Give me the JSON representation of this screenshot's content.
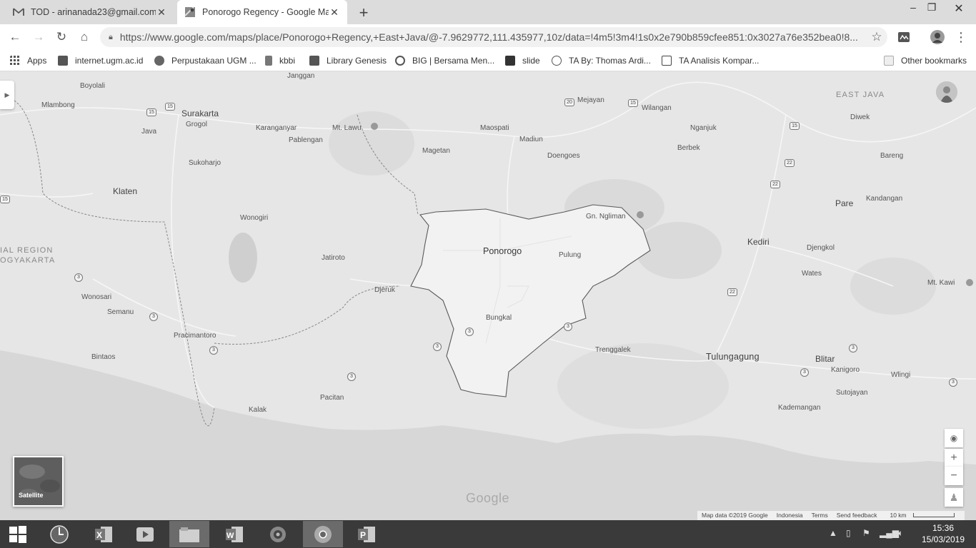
{
  "tabs": [
    {
      "title": "TOD - arinanada23@gmail.com -",
      "icon": "gmail-icon",
      "active": false
    },
    {
      "title": "Ponorogo Regency - Google Maps",
      "icon": "maps-icon",
      "active": true
    }
  ],
  "toolbar": {
    "url": "https://www.google.com/maps/place/Ponorogo+Regency,+East+Java/@-7.9629772,111.435977,10z/data=!4m5!3m4!1s0x2e790b859cfee851:0x3027a76e352bea0!8..."
  },
  "bookmarks": [
    {
      "label": "Apps",
      "icon": "apps-grid-icon"
    },
    {
      "label": "internet.ugm.ac.id",
      "icon": "ugm-icon"
    },
    {
      "label": "Perpustakaan UGM ...",
      "icon": "ugm-library-icon"
    },
    {
      "label": "kbbi",
      "icon": "book-icon"
    },
    {
      "label": "Library Genesis",
      "icon": "libgen-icon"
    },
    {
      "label": "BIG | Bersama Men...",
      "icon": "big-icon"
    },
    {
      "label": "slide",
      "icon": "slide-icon"
    },
    {
      "label": "TA By: Thomas Ardi...",
      "icon": "wordpress-icon"
    },
    {
      "label": "TA Analisis Kompar...",
      "icon": "doc-icon"
    }
  ],
  "other_bookmarks": "Other bookmarks",
  "map": {
    "region_label_top": "EAST JAVA",
    "region_label_left_1": "IAL REGION",
    "region_label_left_2": "OGYAKARTA",
    "selected_place": "Ponorogo",
    "places": {
      "boyolali": "Boyolali",
      "janggan": "Janggan",
      "mejayan": "Mejayan",
      "wilangan": "Wilangan",
      "mlambong": "Mlambong",
      "surakarta": "Surakarta",
      "grogol": "Grogol",
      "java": "Java",
      "karanganyar": "Karanganyar",
      "mtlawu": "Mt. Lawu",
      "pablengan": "Pablengan",
      "maospati": "Maospati",
      "madiun": "Madiun",
      "magetan": "Magetan",
      "doengoes": "Doengoes",
      "nganjuk": "Nganjuk",
      "berbek": "Berbek",
      "diwek": "Diwek",
      "bareng": "Bareng",
      "sukoharjo": "Sukoharjo",
      "klaten": "Klaten",
      "wonogiri": "Wonogiri",
      "gnngliman": "Gn. Ngliman",
      "pare": "Pare",
      "kandangan": "Kandangan",
      "kediri": "Kediri",
      "pulung": "Pulung",
      "jatiroto": "Jatiroto",
      "djengkol": "Djengkol",
      "wates": "Wates",
      "mtkawi": "Mt. Kawi",
      "wonosari": "Wonosari",
      "djeruk": "Djeruk",
      "semanu": "Semanu",
      "bungkal": "Bungkal",
      "pracimantoro": "Pracimantoro",
      "trenggalek": "Trenggalek",
      "tulungagung": "Tulungagung",
      "blitar": "Blitar",
      "bintaos": "Bintaos",
      "kanigoro": "Kanigoro",
      "wlingi": "Wlingi",
      "pacitan": "Pacitan",
      "kalak": "Kalak",
      "sutojayan": "Sutojayan",
      "kademangan": "Kademangan"
    },
    "road_shields": [
      "15",
      "15",
      "20",
      "15",
      "15",
      "22",
      "22",
      "3",
      "3",
      "3",
      "3",
      "3",
      "3",
      "3",
      "22",
      "3",
      "3",
      "15",
      "3"
    ],
    "satellite_label": "Satellite",
    "google_logo": "Google",
    "attribution": {
      "map_data": "Map data ©2019 Google",
      "country": "Indonesia",
      "terms": "Terms",
      "feedback": "Send feedback",
      "scale": "10 km"
    },
    "controls": {
      "zoom_in": "+",
      "zoom_out": "−"
    }
  },
  "taskbar": {
    "time": "15:36",
    "date": "15/03/2019",
    "apps": [
      "windows-start",
      "clock-app",
      "excel",
      "media-player",
      "file-explorer",
      "word",
      "app-swirl",
      "chrome",
      "powerpoint"
    ]
  },
  "colors": {
    "map_land": "#e6e6e6",
    "map_sea": "#d7d7d7",
    "selected_area": "#f2f2f2",
    "taskbar": "#3a3a3a"
  }
}
